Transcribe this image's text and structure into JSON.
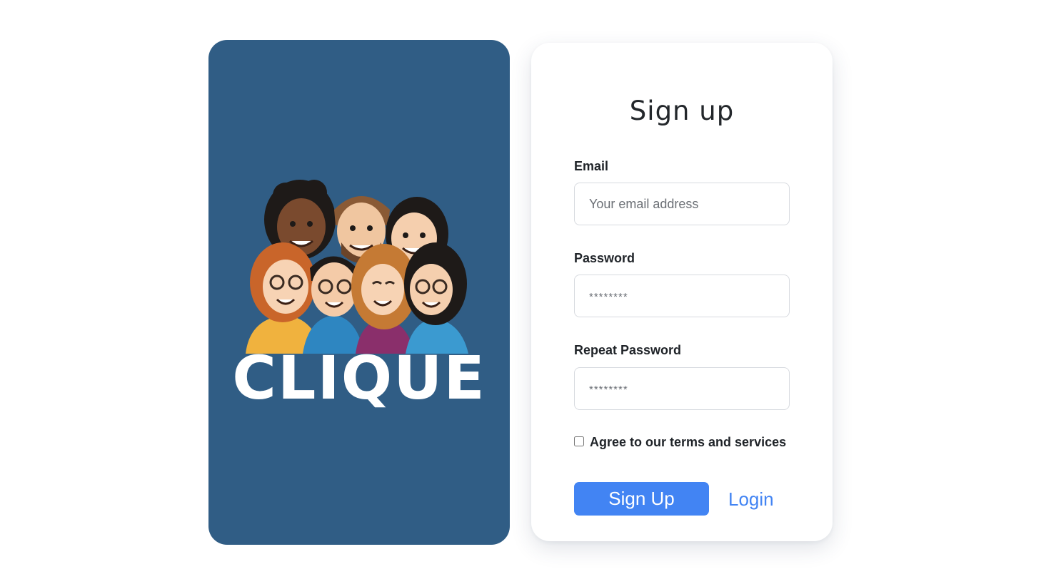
{
  "brand": {
    "logo_text": "CLIQUE",
    "panel_color": "#305d85",
    "illustration": "group-of-friends-cartoon"
  },
  "form": {
    "title": "Sign up",
    "email": {
      "label": "Email",
      "placeholder": "Your email address",
      "value": ""
    },
    "password": {
      "label": "Password",
      "placeholder": "********",
      "value": ""
    },
    "repeat_password": {
      "label": "Repeat Password",
      "placeholder": "********",
      "value": ""
    },
    "terms": {
      "label": "Agree to our terms and services",
      "checked": false
    },
    "submit_label": "Sign Up",
    "login_label": "Login",
    "accent_color": "#4284f3"
  }
}
